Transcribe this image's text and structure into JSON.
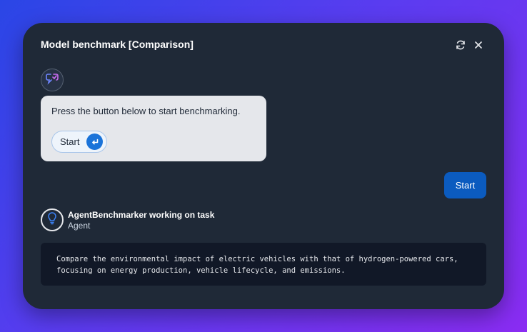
{
  "window": {
    "title": "Model benchmark [Comparison]"
  },
  "header": {
    "refresh_icon": "refresh-icon",
    "close_icon": "close-icon"
  },
  "bot_message": {
    "avatar_icon": "bot-icon",
    "text": "Press the button below to start benchmarking.",
    "button_label": "Start",
    "button_icon": "enter-icon"
  },
  "user_message": {
    "text": "Start"
  },
  "agent": {
    "avatar_icon": "lightbulb-icon",
    "name": "AgentBenchmarker working on task",
    "role": "Agent",
    "task": "Compare the environmental impact of electric vehicles with that of hydrogen-powered cars,\nfocusing on energy production, vehicle lifecycle, and emissions."
  },
  "colors": {
    "panel": "#1f2937",
    "bubble": "#e5e7eb",
    "user_bubble": "#0b5bbf",
    "accent": "#1a73d9",
    "task_box": "#111827"
  }
}
